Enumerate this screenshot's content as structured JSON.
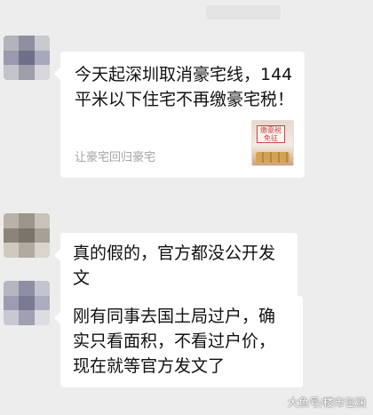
{
  "messages": [
    {
      "type": "link",
      "title": "今天起深圳取消豪宅线，144平米以下住宅不再缴豪宅税！",
      "source": "让豪宅回归豪宅",
      "thumbnail_icon": "news-thumbnail-icon",
      "thumbnail_text": "缴豪税 免征"
    },
    {
      "type": "text",
      "text": "真的假的，官方都没公开发文"
    },
    {
      "type": "text",
      "text": "刚有同事去国土局过户，确实只看面积，不看过户价，现在就等官方发文了"
    }
  ],
  "watermark": "大鱼号/楼市包涵",
  "colors": {
    "background": "#ededed",
    "bubble": "#ffffff",
    "source_text": "#a4a4a4"
  }
}
